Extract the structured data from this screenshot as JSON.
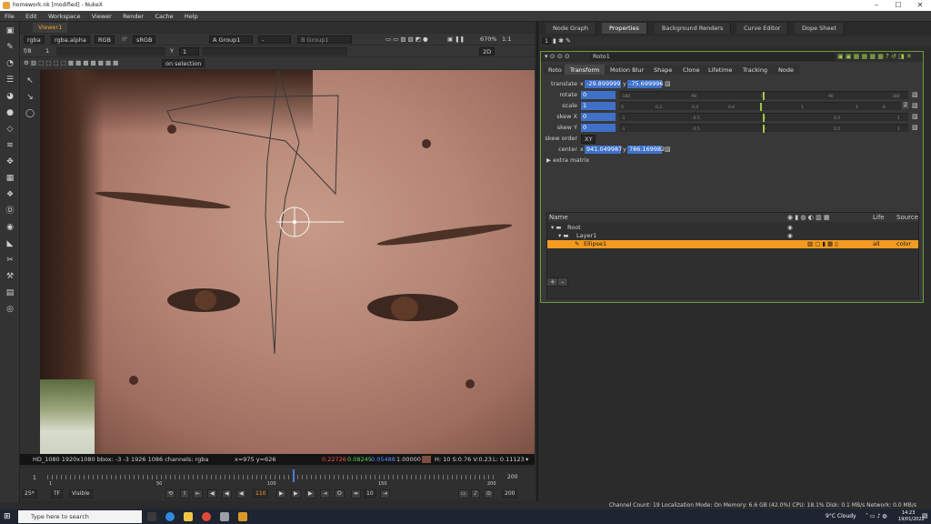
{
  "window": {
    "title": "homework.nk [modified] - NukeX",
    "controls": [
      "–",
      "☐",
      "✕"
    ]
  },
  "menu": [
    "File",
    "Edit",
    "Workspace",
    "Viewer",
    "Render",
    "Cache",
    "Help"
  ],
  "viewer": {
    "tab": "Viewer1",
    "channels": "rgba",
    "channel2": "rgba.alpha",
    "colorspace": "RGB",
    "ip": "IP",
    "lut": "sRGB",
    "a_input": "A Group1",
    "dash": "-",
    "b_input": "B Group1",
    "zoom": "670%",
    "ratio": "1:1",
    "fstop": "f/8",
    "fstop_val": "1",
    "y_label": "Y",
    "y_val": "1",
    "view_mode": "2D",
    "on_selection": "on selection",
    "status": {
      "format": "HD_1080 1920x1080  bbox: -3 -3 1926 1086 channels: rgba",
      "coords": "x=975 y=626",
      "r": "0.22726",
      "g": "0.08245",
      "b": "0.05488",
      "a": "1.00000",
      "hsv": "H: 10 S:0.76 V:0.23",
      "lum": "L: 0.11123",
      "swatch_color": "#7b4f40"
    }
  },
  "timeline": {
    "ticks": [
      "1",
      "50",
      "100",
      "150",
      "200"
    ],
    "start": "1",
    "end": "200",
    "fps": "25*",
    "tf": "TF",
    "visible": "Visible",
    "current_frame": "110",
    "step": "10",
    "end_frame": "200"
  },
  "panel": {
    "tabs": [
      "Node Graph",
      "Properties",
      "Background Renders",
      "Curve Editor",
      "Dope Sheet"
    ],
    "active_tab": "Properties",
    "count": "1",
    "node_name": "Roto1",
    "node_tabs": [
      "Roto",
      "Transform",
      "Motion Blur",
      "Shape",
      "Clone",
      "Lifetime",
      "Tracking",
      "Node"
    ],
    "active_node_tab": "Transform",
    "params": {
      "translate_label": "translate",
      "translate_x": "-29.899999",
      "translate_y": "-75.699996",
      "rotate_label": "rotate",
      "rotate_val": "0",
      "scale_label": "scale",
      "scale_val": "1",
      "skewx_label": "skew X",
      "skewx_val": "0",
      "skewy_label": "skew Y",
      "skewy_val": "0",
      "skeworder_label": "skew order",
      "skeworder_val": "XY",
      "center_label": "center",
      "center_x": "941.049987",
      "center_y": "786.169982",
      "extra_matrix": "extra matrix",
      "x_label": "x",
      "y_label": "y"
    },
    "tree": {
      "col_name": "Name",
      "col_life": "Life",
      "col_source": "Source",
      "rows": [
        {
          "name": "Root",
          "life": "",
          "source": ""
        },
        {
          "name": "Layer1",
          "life": "",
          "source": ""
        },
        {
          "name": "Ellipse1",
          "life": "all",
          "source": "color"
        }
      ],
      "add": "+",
      "remove": "–"
    }
  },
  "status_bar": "Channel Count: 19  Localization Mode: On  Memory: 6.6 GB (42.0%)  CPU: 18.1%  Disk: 0.1 MB/s  Network: 0.0 MB/s",
  "taskbar": {
    "search_placeholder": "Type here to search",
    "weather": "9°C  Cloudy",
    "time": "14:23",
    "date": "19/01/2022"
  }
}
